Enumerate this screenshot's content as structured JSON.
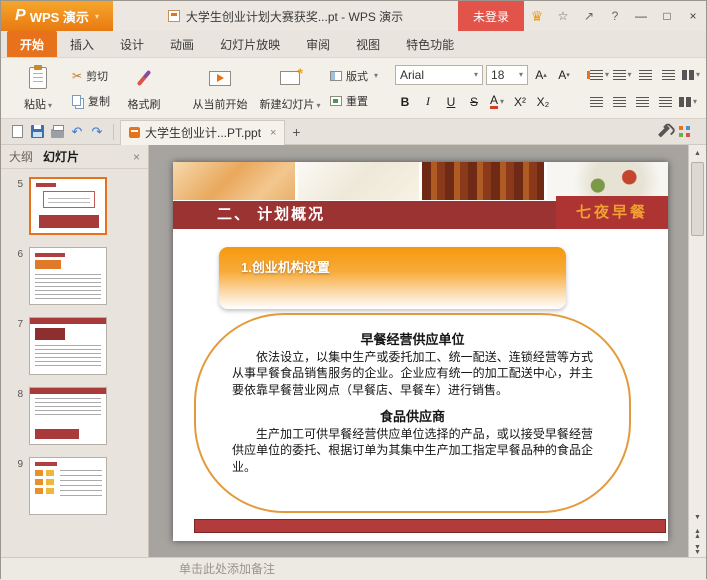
{
  "titlebar": {
    "logo_letter": "P",
    "app_name": "WPS 演示",
    "doc_title": "大学生创业计划大赛获奖...pt - WPS 演示",
    "login_label": "未登录"
  },
  "ribbon": {
    "tabs": [
      {
        "label": "开始"
      },
      {
        "label": "插入"
      },
      {
        "label": "设计"
      },
      {
        "label": "动画"
      },
      {
        "label": "幻灯片放映"
      },
      {
        "label": "审阅"
      },
      {
        "label": "视图"
      },
      {
        "label": "特色功能"
      }
    ],
    "clipboard": {
      "paste": "粘贴",
      "cut": "剪切",
      "copy": "复制",
      "format_painter": "格式刷"
    },
    "slides": {
      "from_current": "从当前开始",
      "new_slide": "新建幻灯片",
      "layout": "版式",
      "reset": "重置"
    },
    "font": {
      "name": "Arial",
      "size": "18",
      "grow": "A",
      "shrink": "A",
      "bold": "B",
      "italic": "I",
      "underline": "U",
      "strike": "S",
      "color_a": "A",
      "sup": "X²",
      "sub": "X₂"
    }
  },
  "quickbar": {
    "doc_tab": "大学生创业计...PT.ppt"
  },
  "sidebar": {
    "outline_tab": "大纲",
    "slides_tab": "幻灯片",
    "slides": [
      {
        "number": "5"
      },
      {
        "number": "6"
      },
      {
        "number": "7"
      },
      {
        "number": "8"
      },
      {
        "number": "9"
      }
    ]
  },
  "slide": {
    "title": "二、 计划概况",
    "brand": "七夜早餐",
    "section": "1.创业机构设置",
    "heading1": "早餐经营供应单位",
    "para1": "依法设立，以集中生产或委托加工、统一配送、连锁经营等方式从事早餐食品销售服务的企业。企业应有统一的加工配送中心，并主要依靠早餐营业网点（早餐店、早餐车）进行销售。",
    "heading2": "食品供应商",
    "para2": "生产加工可供早餐经营供应单位选择的产品，或以接受早餐经营供应单位的委托、根据订单为其集中生产加工指定早餐品种的食品企业。"
  },
  "notes": {
    "placeholder": "单击此处添加备注"
  },
  "colors": {
    "accent_orange": "#e8721c",
    "banner_red": "#9b3332",
    "brand_red": "#ae3434",
    "brand_text": "#f0a030",
    "login_red": "#e2544a"
  }
}
